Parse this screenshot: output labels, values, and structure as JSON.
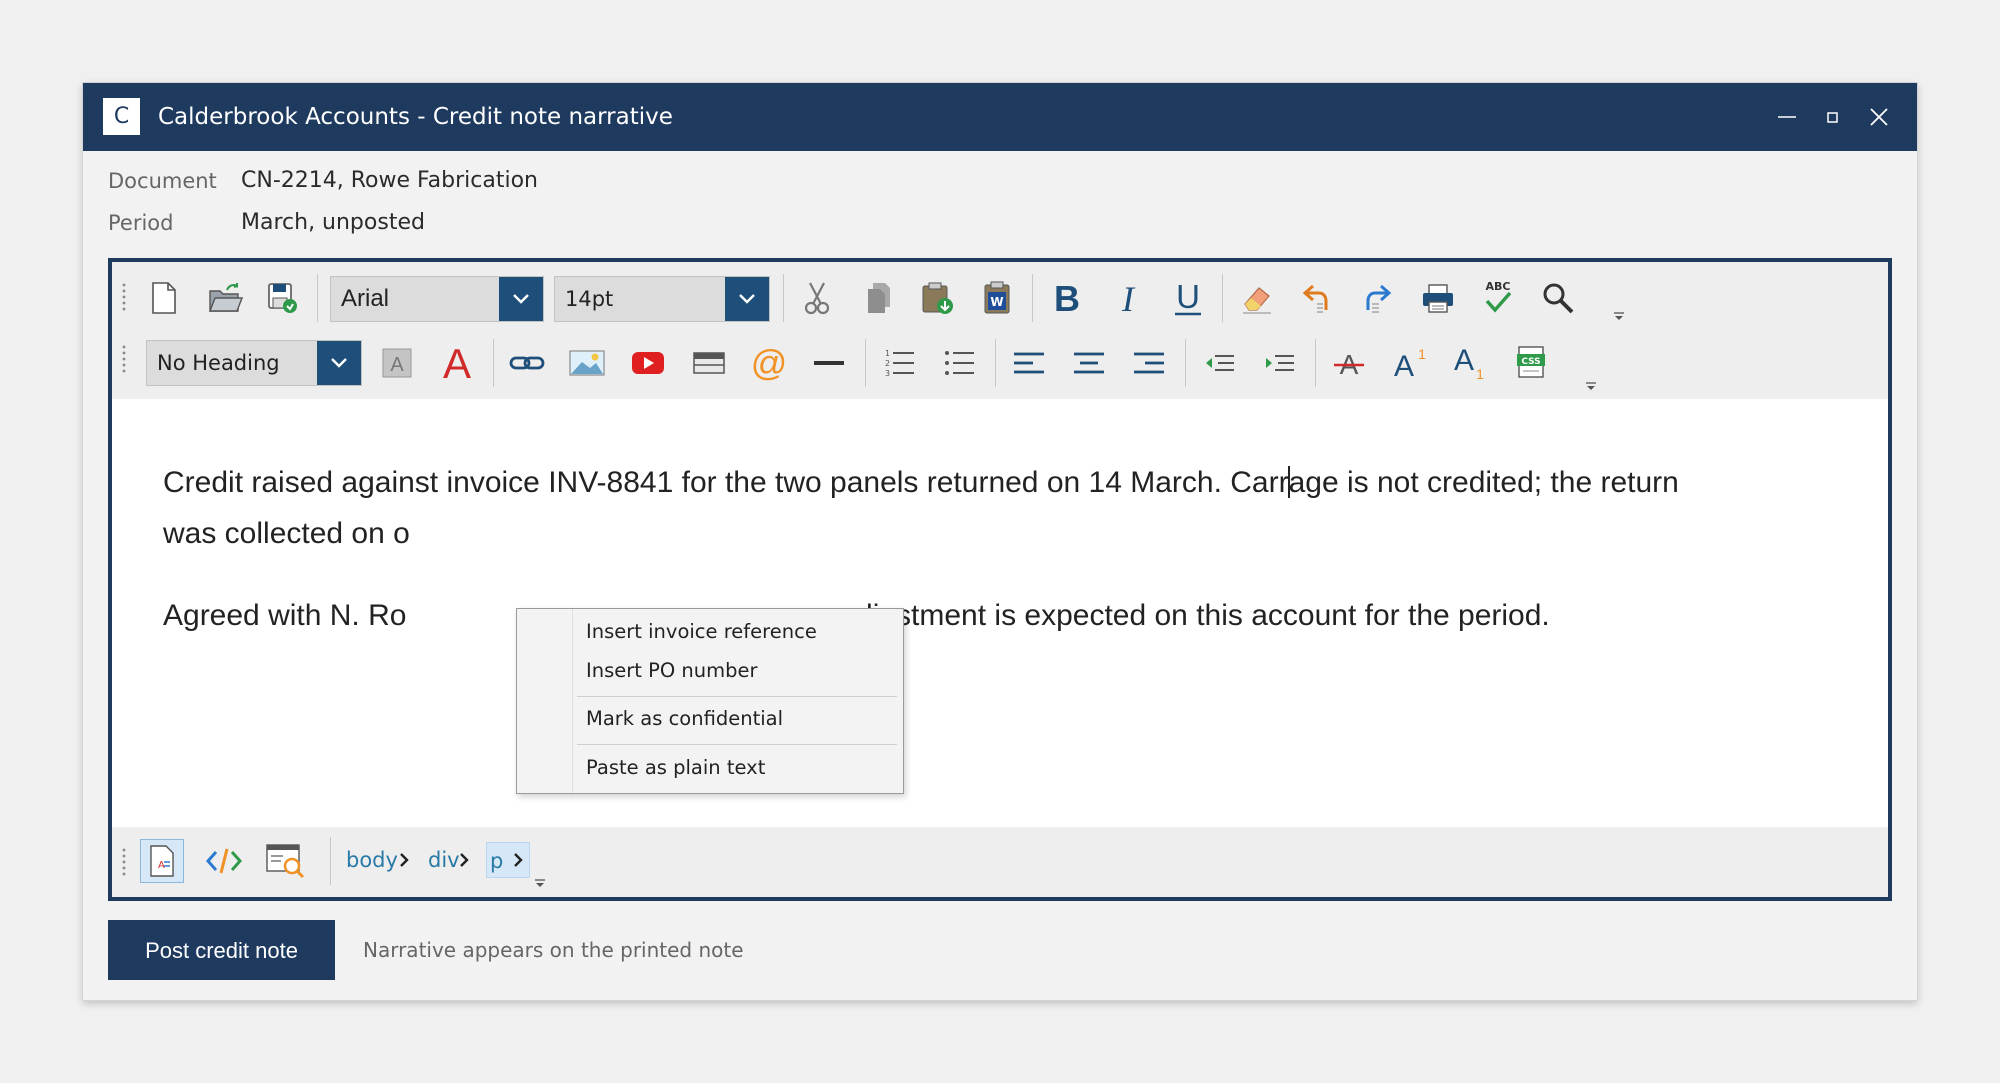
{
  "window": {
    "app_icon_letter": "C",
    "title": "Calderbrook Accounts - Credit note narrative"
  },
  "meta": {
    "document_label": "Document",
    "document_value": "CN-2214, Rowe Fabrication",
    "period_label": "Period",
    "period_value": "March, unposted"
  },
  "toolbar": {
    "font_family": "Arial",
    "font_size": "14pt",
    "heading": "No Heading"
  },
  "content": {
    "para1_line1_before_caret": "Credit raised against invoice INV-8841 for the two panels returned on 14 March. Carr",
    "para1_line1_after_caret": "age is not credited; the return",
    "para1_line2_visible": "was collected on o",
    "para2_left_visible": "Agreed with N. Ro",
    "para2_right_visible": "r adjustment is expected on this account for the period."
  },
  "context_menu": {
    "items": [
      "Insert invoice reference",
      "Insert PO number",
      "Mark as confidential",
      "Paste as plain text"
    ]
  },
  "breadcrumb": [
    "body",
    "div",
    "p"
  ],
  "footer": {
    "post_button": "Post credit note",
    "hint": "Narrative appears on the printed note"
  },
  "colors": {
    "title_bar": "#1e3a5f",
    "accent_blue": "#1e4e7a",
    "link": "#2a7aa8",
    "red": "#d12a2a"
  },
  "icons": {
    "toolbar_row1": [
      "new-document-icon",
      "open-folder-icon",
      "save-icon",
      "cut-icon",
      "copy-icon",
      "paste-icon",
      "paste-from-word-icon",
      "bold-icon",
      "italic-icon",
      "underline-icon",
      "eraser-icon",
      "undo-icon",
      "redo-icon",
      "print-icon",
      "spellcheck-icon",
      "find-icon"
    ],
    "toolbar_row2": [
      "background-color-icon",
      "font-color-icon",
      "link-icon",
      "image-icon",
      "video-icon",
      "table-icon",
      "email-icon",
      "horizontal-rule-icon",
      "ordered-list-icon",
      "unordered-list-icon",
      "align-left-icon",
      "align-center-icon",
      "align-right-icon",
      "outdent-icon",
      "indent-icon",
      "strikethrough-icon",
      "superscript-icon",
      "subscript-icon",
      "css-icon"
    ],
    "status_bar": [
      "design-view-icon",
      "code-view-icon",
      "preview-icon"
    ]
  }
}
